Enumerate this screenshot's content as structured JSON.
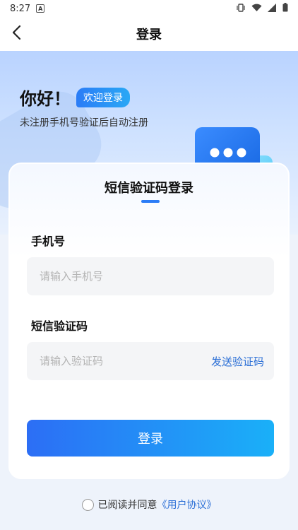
{
  "status": {
    "time": "8:27",
    "notification_letter": "A"
  },
  "nav": {
    "title": "登录"
  },
  "hero": {
    "hello": "你好！",
    "badge": "欢迎登录",
    "subtitle": "未注册手机号验证后自动注册"
  },
  "card": {
    "title": "短信验证码登录",
    "phone_label": "手机号",
    "phone_placeholder": "请输入手机号",
    "code_label": "短信验证码",
    "code_placeholder": "请输入验证码",
    "send_code": "发送验证码",
    "login_button": "登录"
  },
  "agreement": {
    "prefix": "已阅读并同意",
    "link": "《用户协议》"
  },
  "colors": {
    "accent": "#2b7cf6",
    "link": "#2b6fd6",
    "button_start": "#2c6ef5",
    "button_end": "#1ab0f8"
  }
}
